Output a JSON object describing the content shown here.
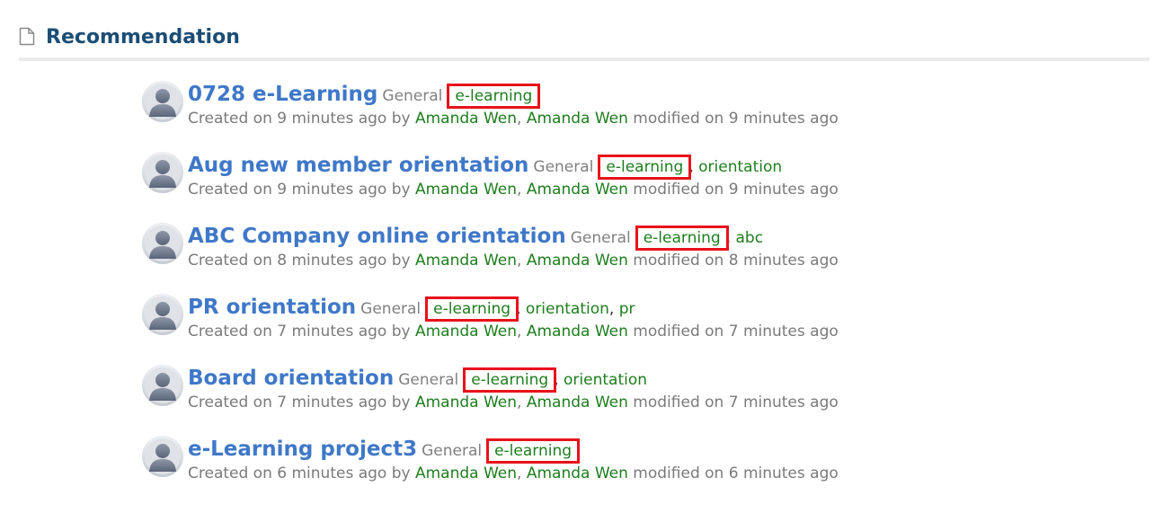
{
  "section": {
    "title": "Recommendation",
    "icon": "document-icon"
  },
  "colors": {
    "title_blue": "#3f78c8",
    "header_blue": "#1b4d75",
    "tag_green": "#1e7d1e",
    "meta_gray": "#7a7a7a",
    "highlight_red": "#e8121b"
  },
  "text": {
    "created_prefix": "Created on",
    "by": "by",
    "comma": ",",
    "modified_on": "modified on"
  },
  "items": [
    {
      "title": "0728 e-Learning",
      "category": "General",
      "tags": [
        {
          "label": "e-learning",
          "highlighted": true
        }
      ],
      "created": "9 minutes ago",
      "author": "Amanda Wen",
      "modifier": "Amanda Wen",
      "modified": "9 minutes ago"
    },
    {
      "title": "Aug new member orientation",
      "category": "General",
      "tags": [
        {
          "label": "e-learning",
          "highlighted": true
        },
        {
          "label": "orientation",
          "highlighted": false
        }
      ],
      "created": "9 minutes ago",
      "author": "Amanda Wen",
      "modifier": "Amanda Wen",
      "modified": "9 minutes ago"
    },
    {
      "title": "ABC Company online orientation",
      "category": "General",
      "tags": [
        {
          "label": "e-learning",
          "highlighted": true
        },
        {
          "label": "abc",
          "highlighted": false
        }
      ],
      "created": "8 minutes ago",
      "author": "Amanda Wen",
      "modifier": "Amanda Wen",
      "modified": "8 minutes ago"
    },
    {
      "title": "PR orientation",
      "category": "General",
      "tags": [
        {
          "label": "e-learning",
          "highlighted": true
        },
        {
          "label": "orientation",
          "highlighted": false
        },
        {
          "label": "pr",
          "highlighted": false
        }
      ],
      "created": "7 minutes ago",
      "author": "Amanda Wen",
      "modifier": "Amanda Wen",
      "modified": "7 minutes ago"
    },
    {
      "title": "Board orientation",
      "category": "General",
      "tags": [
        {
          "label": "e-learning",
          "highlighted": true
        },
        {
          "label": "orientation",
          "highlighted": false
        }
      ],
      "created": "7 minutes ago",
      "author": "Amanda Wen",
      "modifier": "Amanda Wen",
      "modified": "7 minutes ago"
    },
    {
      "title": "e-Learning project3",
      "category": "General",
      "tags": [
        {
          "label": "e-learning",
          "highlighted": true
        }
      ],
      "created": "6 minutes ago",
      "author": "Amanda Wen",
      "modifier": "Amanda Wen",
      "modified": "6 minutes ago"
    }
  ]
}
